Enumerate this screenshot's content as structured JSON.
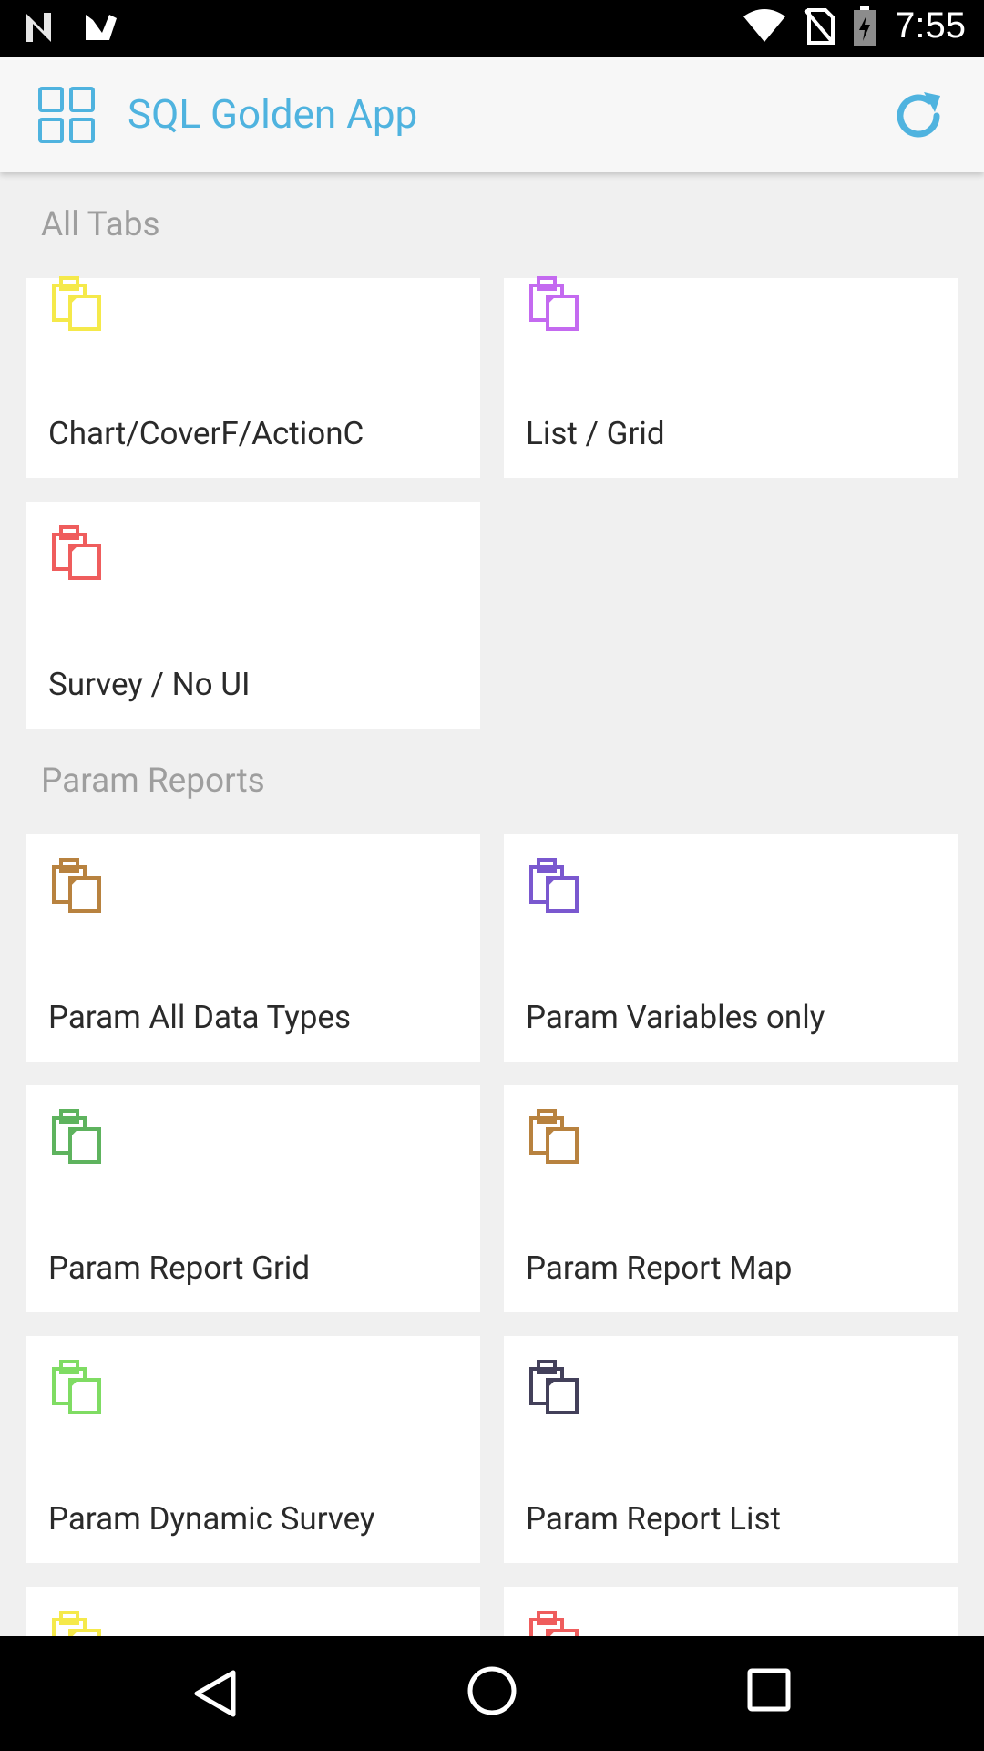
{
  "status_bar": {
    "time": "7:55"
  },
  "app_bar": {
    "title": "SQL Golden App",
    "logo_icon": "grid-icon",
    "refresh_icon": "refresh-icon"
  },
  "sections": [
    {
      "title": "All Tabs",
      "cards": [
        {
          "label": "Chart/CoverF/ActionC",
          "icon_color": "#f5e94a"
        },
        {
          "label": "List / Grid",
          "icon_color": "#c46af0"
        },
        {
          "label": "Survey / No UI",
          "icon_color": "#ef5d5d"
        }
      ]
    },
    {
      "title": "Param Reports",
      "cards": [
        {
          "label": "Param All Data Types",
          "icon_color": "#b8823f"
        },
        {
          "label": "Param Variables only",
          "icon_color": "#7a58cf"
        },
        {
          "label": "Param Report Grid",
          "icon_color": "#5eb35e"
        },
        {
          "label": "Param Report Map",
          "icon_color": "#b8823f"
        },
        {
          "label": "Param Dynamic Survey",
          "icon_color": "#7fdc63"
        },
        {
          "label": "Param Report List",
          "icon_color": "#43405a"
        },
        {
          "label": "",
          "icon_color": "#f5e94a"
        },
        {
          "label": "",
          "icon_color": "#ef5d5d"
        }
      ]
    }
  ]
}
